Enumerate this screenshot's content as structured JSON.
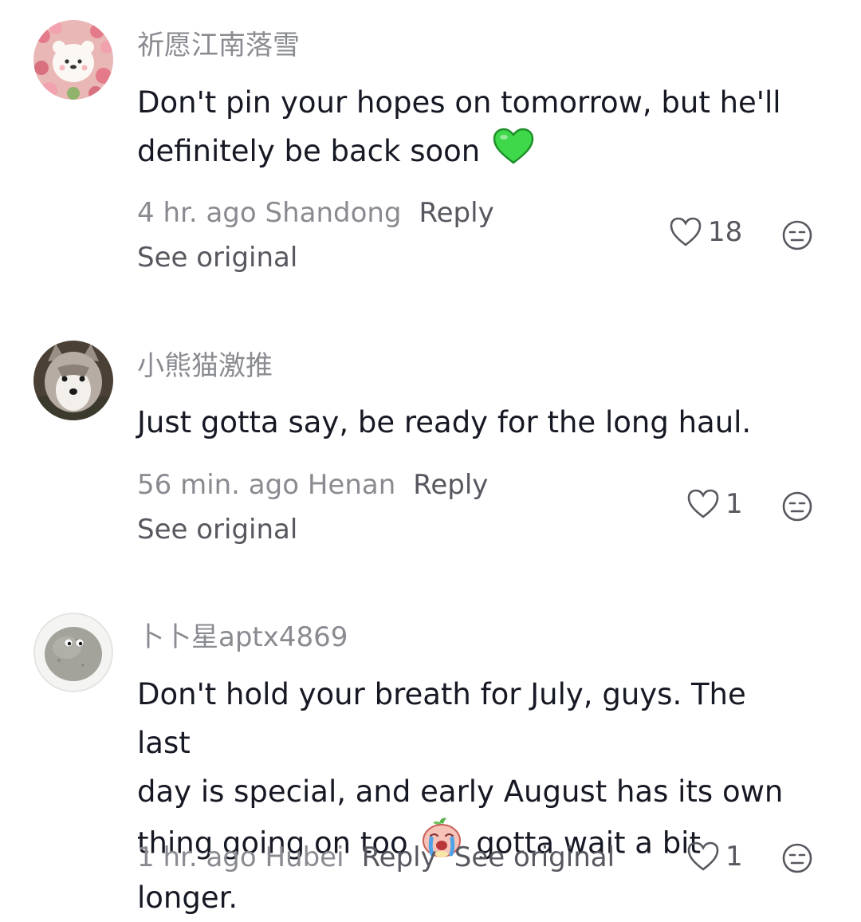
{
  "comments": [
    {
      "username": "祈愿江南落雪",
      "text_line1": "Don't pin your hopes on tomorrow, but he'll",
      "text_line2": "definitely be back soon",
      "emoji": "green-heart-emoji",
      "time_location": "4 hr. ago Shandong",
      "reply": "Reply",
      "see_original": "See original",
      "likes": "18"
    },
    {
      "username": "小熊猫激推",
      "text_line1": "Just gotta say, be ready for the long haul.",
      "time_location": "56 min. ago Henan",
      "reply": "Reply",
      "see_original": "See original",
      "likes": "1"
    },
    {
      "username": "卜卜星aptx4869",
      "text_line1": "Don't hold your breath for July, guys. The last",
      "text_line2": "day is special, and early August has its own",
      "text_line3a": "thing going on too",
      "text_line3b": "gotta wait a bit longer.",
      "emoji": "crying-peach-emoji",
      "time_location": "1 hr. ago Hubei",
      "reply": "Reply",
      "see_original": "See original",
      "likes": "1"
    }
  ],
  "colors": {
    "text_primary": "#161823",
    "text_secondary": "#8a8b91",
    "action": "#57585f",
    "green_heart": "#3fd84a"
  }
}
